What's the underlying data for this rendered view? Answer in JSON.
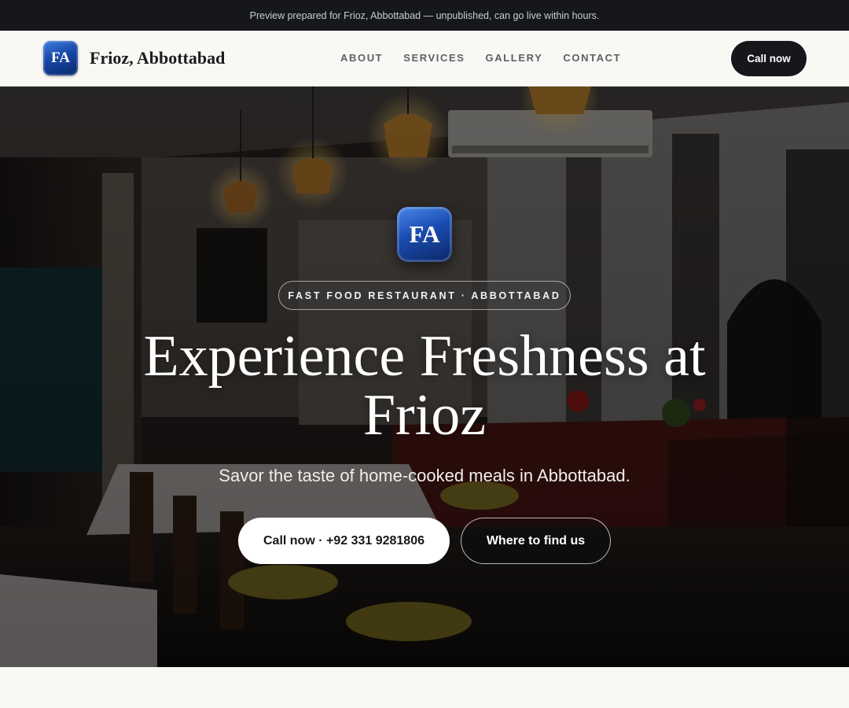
{
  "preview_bar": {
    "text": "Preview prepared for Frioz, Abbottabad — unpublished, can go live within hours."
  },
  "header": {
    "logo_initials": "FA",
    "brand_name": "Frioz, Abbottabad",
    "nav": [
      {
        "label": "ABOUT"
      },
      {
        "label": "SERVICES"
      },
      {
        "label": "GALLERY"
      },
      {
        "label": "CONTACT"
      }
    ],
    "cta_label": "Call now"
  },
  "hero": {
    "logo_initials": "FA",
    "badge": "FAST FOOD RESTAURANT · ABBOTTABAD",
    "title": "Experience Freshness at Frioz",
    "subtitle": "Savor the taste of home-cooked meals in Abbottabad.",
    "primary_button": "Call now · +92 331 9281806",
    "secondary_button": "Where to find us",
    "background_image": "restaurant-interior-photo"
  },
  "colors": {
    "dark": "#15171b",
    "page_background": "#f9f8f5",
    "logo_blue": "#1747a6",
    "nav_text": "#5d6068"
  }
}
